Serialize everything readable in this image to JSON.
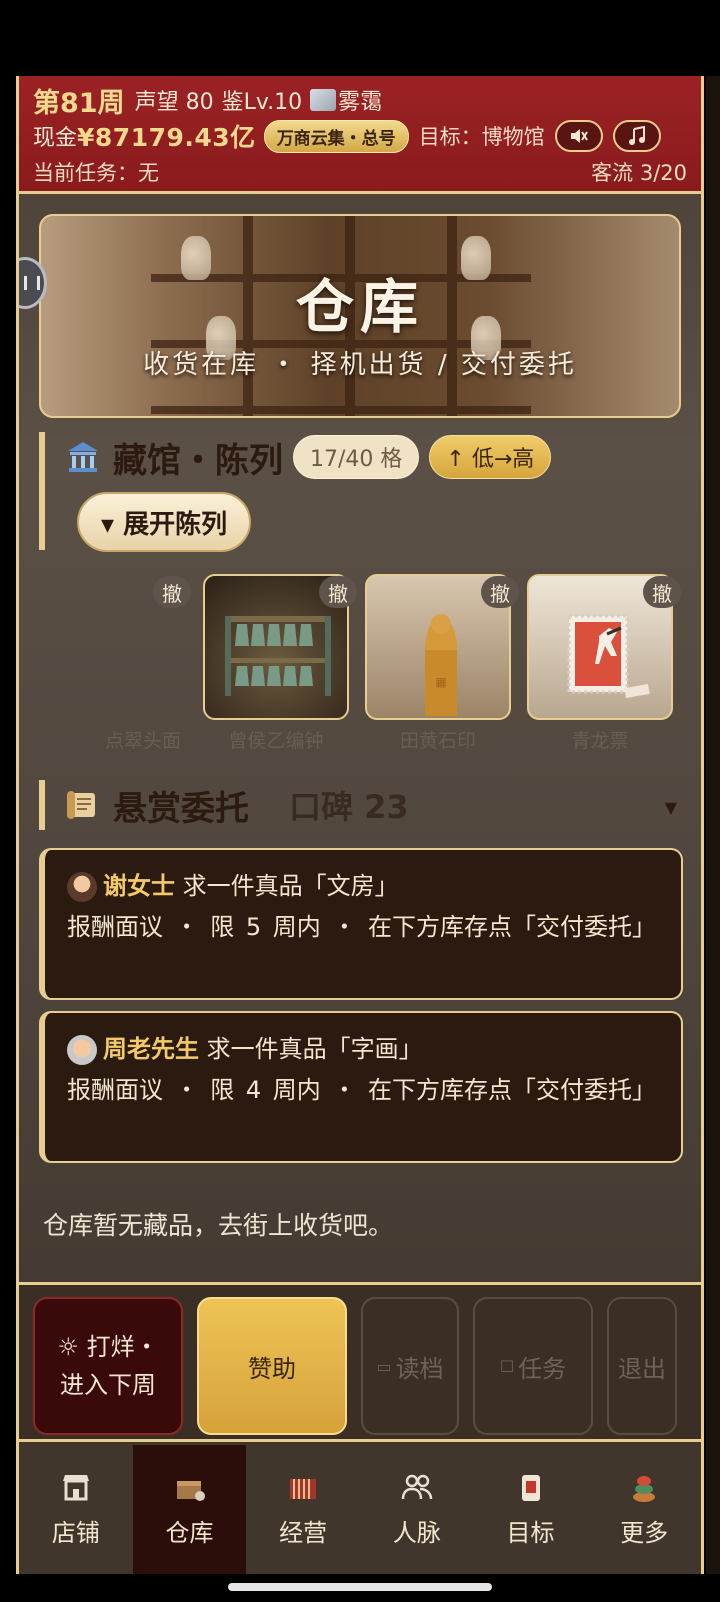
{
  "header": {
    "week": "第81周",
    "reputation": "声望 80",
    "appraisal_level": "鉴Lv.10",
    "weather": "雾霭",
    "cash_label": "现金",
    "cash_value": "¥87179.43亿",
    "company_badge": "万商云集・总号",
    "goal": "目标：博物馆",
    "mute_icon": "mute-icon",
    "music_icon": "music-note-icon",
    "current_task": "当前任务：无",
    "guests": "客流 3/20"
  },
  "banner": {
    "title": "仓库",
    "subtitle": "收货在库 ・ 择机出货 / 交付委托"
  },
  "exhibit": {
    "title": "藏馆・陈列",
    "slots": "17/40 格",
    "sort": "↑ 低→高",
    "expand": "▾ 展开陈列",
    "revoke_label": "撤",
    "items": [
      {
        "name": "点翠头面"
      },
      {
        "name": "曾侯乙编钟"
      },
      {
        "name": "田黄石印"
      },
      {
        "name": "青龙票"
      }
    ]
  },
  "bounty": {
    "title": "悬赏委托",
    "reputation": "口碑 23",
    "cards": [
      {
        "name": "谢女士",
        "request": " 求一件真品「文房」",
        "detail": "报酬面议 ・ 限 5 周内 ・ 在下方库存点「交付委托」"
      },
      {
        "name": "周老先生",
        "request": " 求一件真品「字画」",
        "detail": "报酬面议 ・ 限 4 周内 ・ 在下方库存点「交付委托」"
      }
    ]
  },
  "empty_text": "仓库暂无藏品，去街上收货吧。",
  "actions": {
    "advance": "☼ 打烊・进入下周",
    "sponsor": "赞助",
    "load": "读档",
    "tasks": "任务",
    "exit": "退出"
  },
  "nav": [
    {
      "label": "店铺",
      "icon": "shop-icon"
    },
    {
      "label": "仓库",
      "icon": "warehouse-icon"
    },
    {
      "label": "经营",
      "icon": "ledger-icon"
    },
    {
      "label": "人脉",
      "icon": "people-icon"
    },
    {
      "label": "目标",
      "icon": "scroll-icon"
    },
    {
      "label": "更多",
      "icon": "more-icon"
    }
  ],
  "colors": {
    "accent_gold": "#e7cd8f",
    "header_red": "#9b2224",
    "panel_dark": "#2a1a0f"
  }
}
